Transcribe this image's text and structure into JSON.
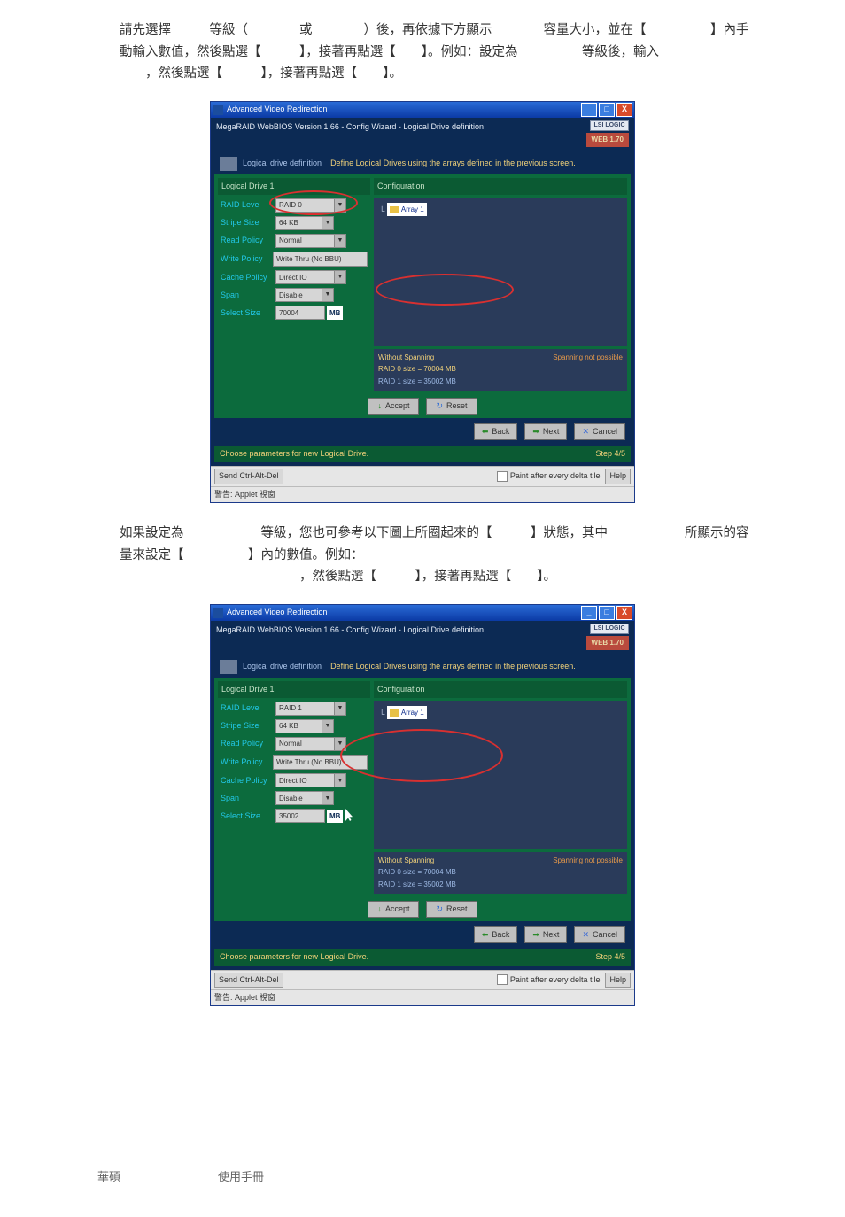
{
  "paragraphs": {
    "p1": "請先選擇　　　等級（　　　　或　　　　）後，再依據下方顯示　　　　容量大小，並在【　　　　　】內手動輸入數值，然後點選【　　　】，接著再點選【　　】。例如：設定為　　　　　等級後，輸入",
    "p1b": "　　，然後點選【　　　】，接著再點選【　　】。",
    "p2": "如果設定為　　　　　　等級，您也可參考以下圖上所圈起來的【　　　】狀態，其中　　　　　　所顯示的容量來設定【　　　　　】內的數值。例如：",
    "p2b": "　　　　　　　　　　　　　　，然後點選【　　　】，接著再點選【　　】。"
  },
  "window": {
    "title": "Advanced Video Redirection",
    "header": "MegaRAID WebBIOS Version 1.66 - Config Wizard - Logical Drive definition",
    "lsi": "LSI LOGIC",
    "webver": "WEB 1.70",
    "section_title": "Logical drive definition",
    "section_desc": "Define Logical Drives using the arrays defined in the previous screen.",
    "logical_drive": "Logical Drive 1",
    "configuration": "Configuration",
    "labels": {
      "raid": "RAID Level",
      "stripe": "Stripe Size",
      "read": "Read Policy",
      "write": "Write Policy",
      "cache": "Cache Policy",
      "span": "Span",
      "size": "Select Size"
    },
    "write_val": "Write Thru (No BBU)",
    "cache_val": "Direct IO",
    "span_val": "Disable",
    "mb": "MB",
    "array1": "Array 1",
    "without_spanning": "Without Spanning",
    "spanning_not": "Spanning not possible",
    "accept": "Accept",
    "reset": "Reset",
    "back": "Back",
    "next": "Next",
    "cancel": "Cancel",
    "footer_left": "Choose parameters for new Logical Drive.",
    "footer_right": "Step 4/5",
    "send": "Send Ctrl-Alt-Del",
    "paint": "Paint after every delta tile",
    "help": "Help",
    "applet": "警告: Applet 視窗"
  },
  "shot1": {
    "raid_val": "RAID 0",
    "stripe_val": "64 KB",
    "read_val": "Normal",
    "size_val": "70004",
    "raid0_line": "RAID 0 size = 70004 MB",
    "raid1_line": "RAID 1 size = 35002 MB"
  },
  "shot2": {
    "raid_val": "RAID 1",
    "stripe_val": "64 KB",
    "read_val": "Normal",
    "size_val": "35002",
    "raid0_line": "RAID 0 size = 70004 MB",
    "raid1_line": "RAID 1 size = 35002 MB"
  },
  "page_footer": {
    "brand": "華碩",
    "manual": "使用手冊"
  }
}
